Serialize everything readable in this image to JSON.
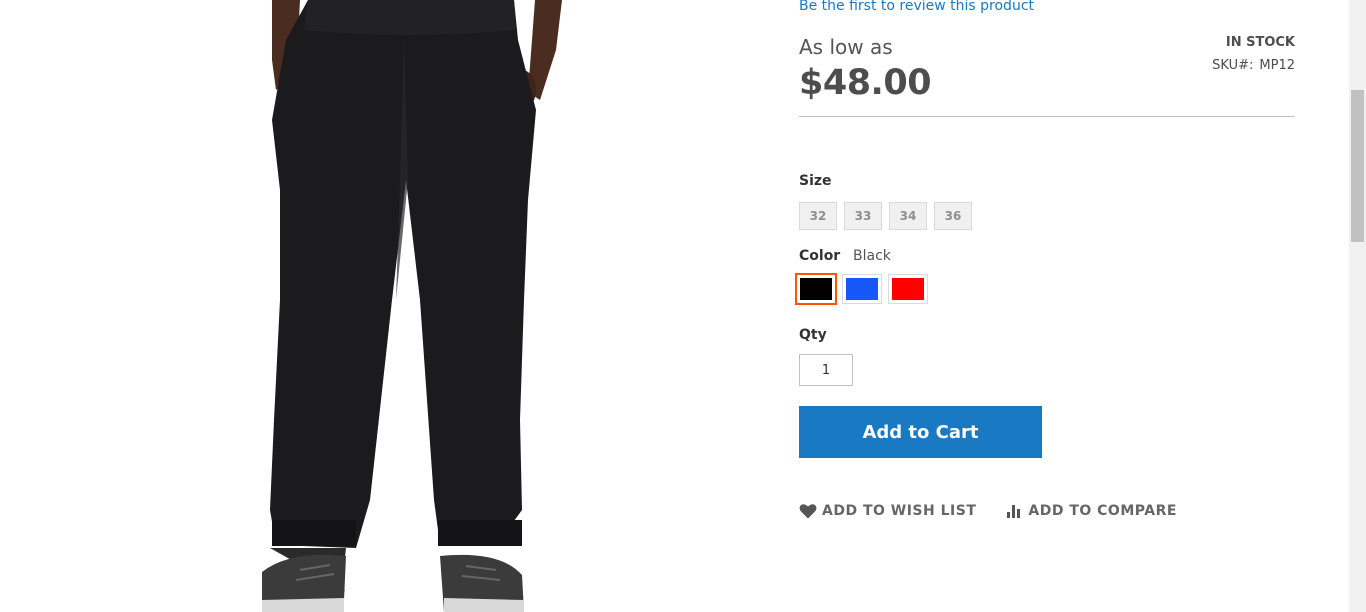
{
  "product": {
    "review_link": "Be the first to review this product",
    "price_label": "As low as",
    "price": "$48.00",
    "stock_status": "IN STOCK",
    "sku_label": "SKU#:",
    "sku_value": "MP12"
  },
  "options": {
    "size_label": "Size",
    "sizes": [
      "32",
      "33",
      "34",
      "36"
    ],
    "color_label": "Color",
    "color_selected": "Black",
    "colors": [
      {
        "name": "Black",
        "hex": "#000000",
        "selected": true
      },
      {
        "name": "Blue",
        "hex": "#1857f7",
        "selected": false
      },
      {
        "name": "Red",
        "hex": "#ff0000",
        "selected": false
      }
    ]
  },
  "qty": {
    "label": "Qty",
    "value": "1"
  },
  "buttons": {
    "add_to_cart": "Add to Cart",
    "wish_list": "ADD TO WISH LIST",
    "compare": "ADD TO COMPARE"
  },
  "icons": {
    "wish_list": "heart-icon",
    "compare": "bar-chart-icon"
  },
  "colors": {
    "link": "#1979c3",
    "primary_button": "#1979c3",
    "selected_swatch_outline": "#ff5501"
  }
}
